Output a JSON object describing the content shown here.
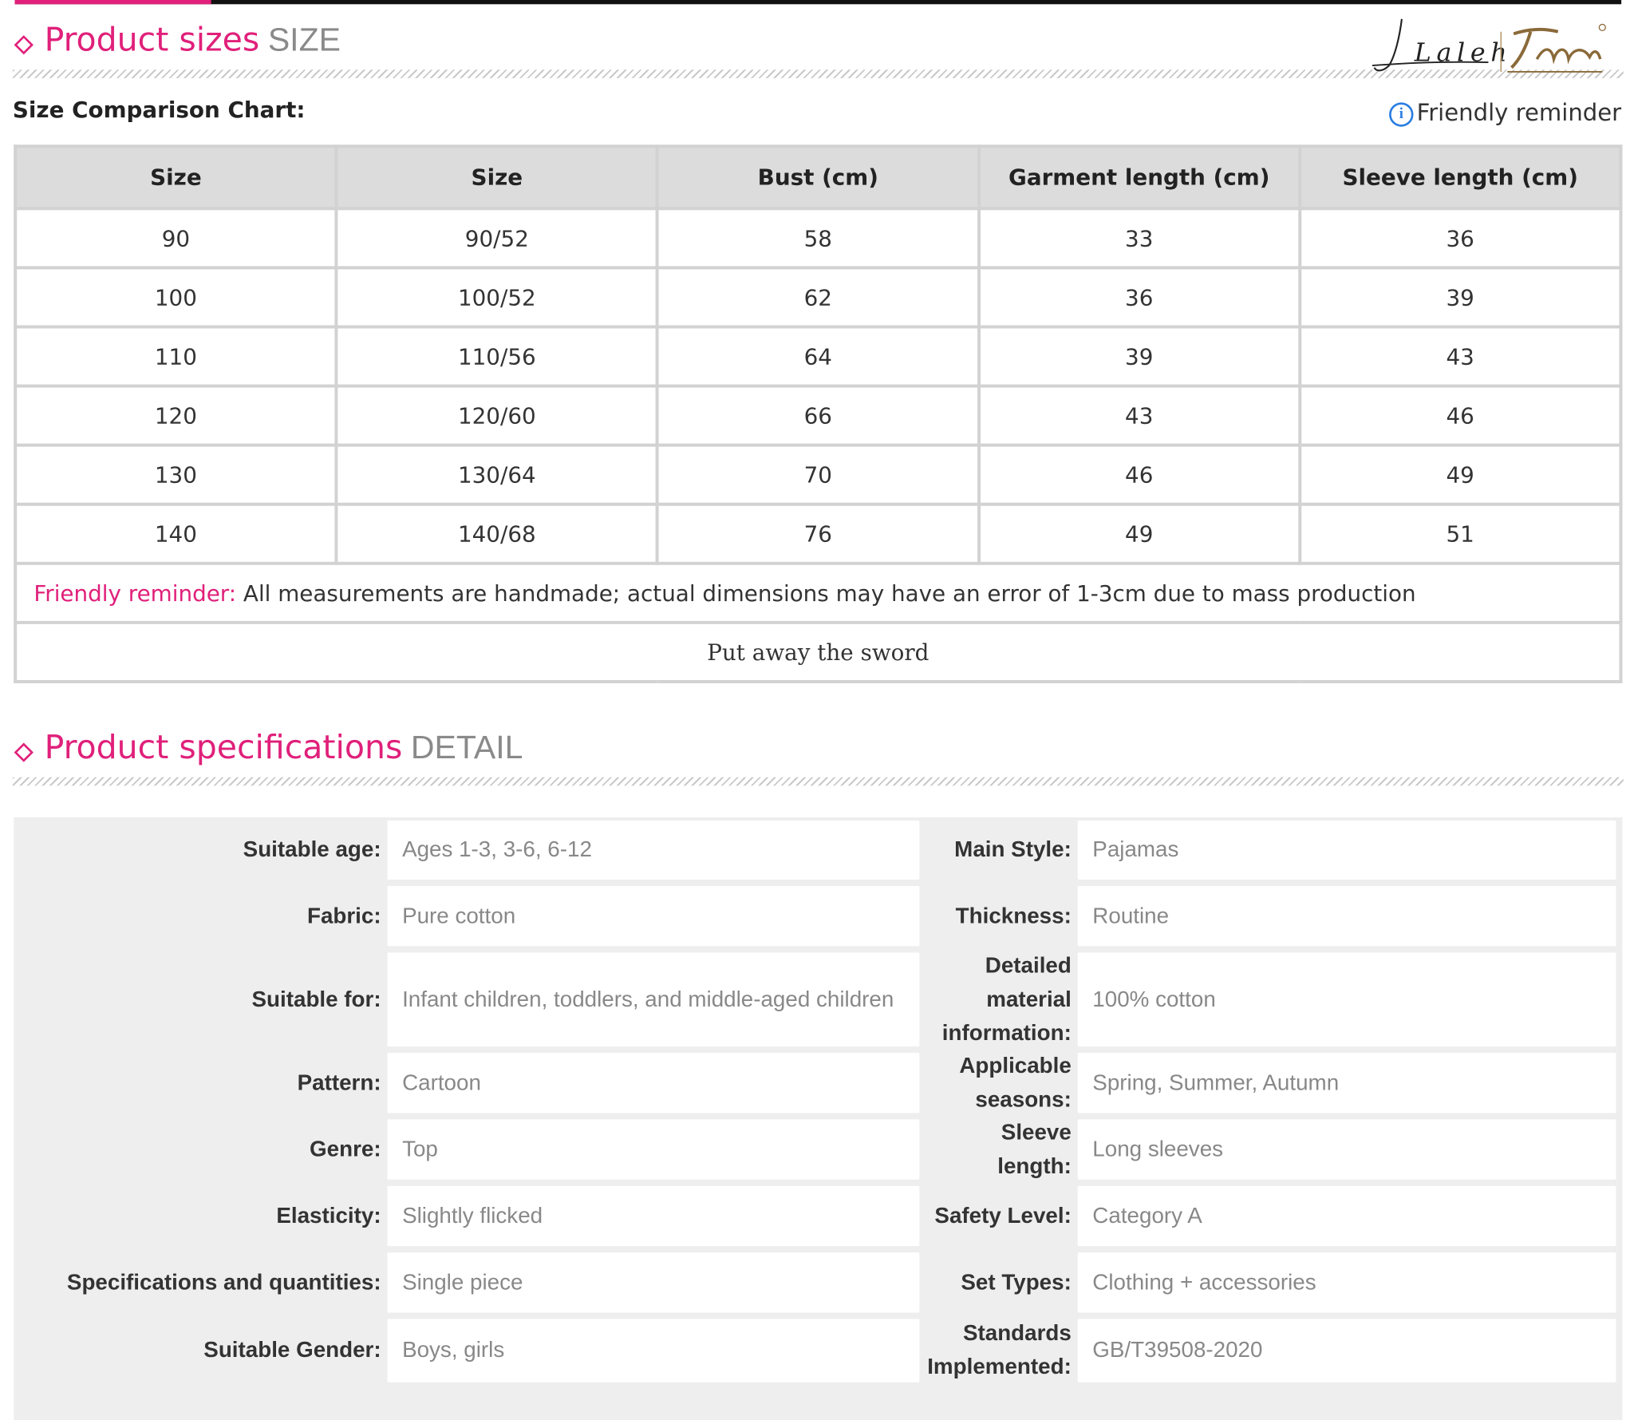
{
  "size_section": {
    "title": "Product sizes",
    "title_en": "SIZE",
    "chart_title": "Size Comparison Chart:",
    "reminder_link": "Friendly reminder",
    "logo_text": "Laleh"
  },
  "size_table": {
    "headers": [
      "Size",
      "Size",
      "Bust (cm)",
      "Garment length (cm)",
      "Sleeve length (cm)"
    ],
    "rows": [
      [
        "90",
        "90/52",
        "58",
        "33",
        "36"
      ],
      [
        "100",
        "100/52",
        "62",
        "36",
        "39"
      ],
      [
        "110",
        "110/56",
        "64",
        "39",
        "43"
      ],
      [
        "120",
        "120/60",
        "66",
        "43",
        "46"
      ],
      [
        "130",
        "130/64",
        "70",
        "46",
        "49"
      ],
      [
        "140",
        "140/68",
        "76",
        "49",
        "51"
      ]
    ],
    "note_label": "Friendly reminder:",
    "note_text": " All measurements are handmade; actual dimensions may have an error of 1-3cm due to mass production",
    "slogan": "Put away the sword"
  },
  "spec_section": {
    "title": "Product specifications",
    "title_en": "DETAIL"
  },
  "specs": [
    {
      "l1": "Suitable age:",
      "v1": "Ages 1-3, 3-6, 6-12",
      "l2": "Main Style:",
      "v2": "Pajamas"
    },
    {
      "l1": "Fabric:",
      "v1": "Pure cotton",
      "l2": "Thickness:",
      "v2": "Routine"
    },
    {
      "l1": "Suitable for:",
      "v1": "Infant children, toddlers, and middle-aged children",
      "l2": "Detailed material information:",
      "v2": "100% cotton"
    },
    {
      "l1": "Pattern:",
      "v1": "Cartoon",
      "l2": "Applicable seasons:",
      "v2": "Spring, Summer, Autumn"
    },
    {
      "l1": "Genre:",
      "v1": "Top",
      "l2": "Sleeve length:",
      "v2": "Long sleeves"
    },
    {
      "l1": "Elasticity:",
      "v1": "Slightly flicked",
      "l2": "Safety Level:",
      "v2": "Category A"
    },
    {
      "l1": "Specifications and quantities:",
      "v1": "Single piece",
      "l2": "Set Types:",
      "v2": "Clothing + accessories"
    },
    {
      "l1": "Suitable Gender:",
      "v1": "Boys, girls",
      "l2": "Standards Implemented:",
      "v2": "GB/T39508-2020"
    }
  ]
}
